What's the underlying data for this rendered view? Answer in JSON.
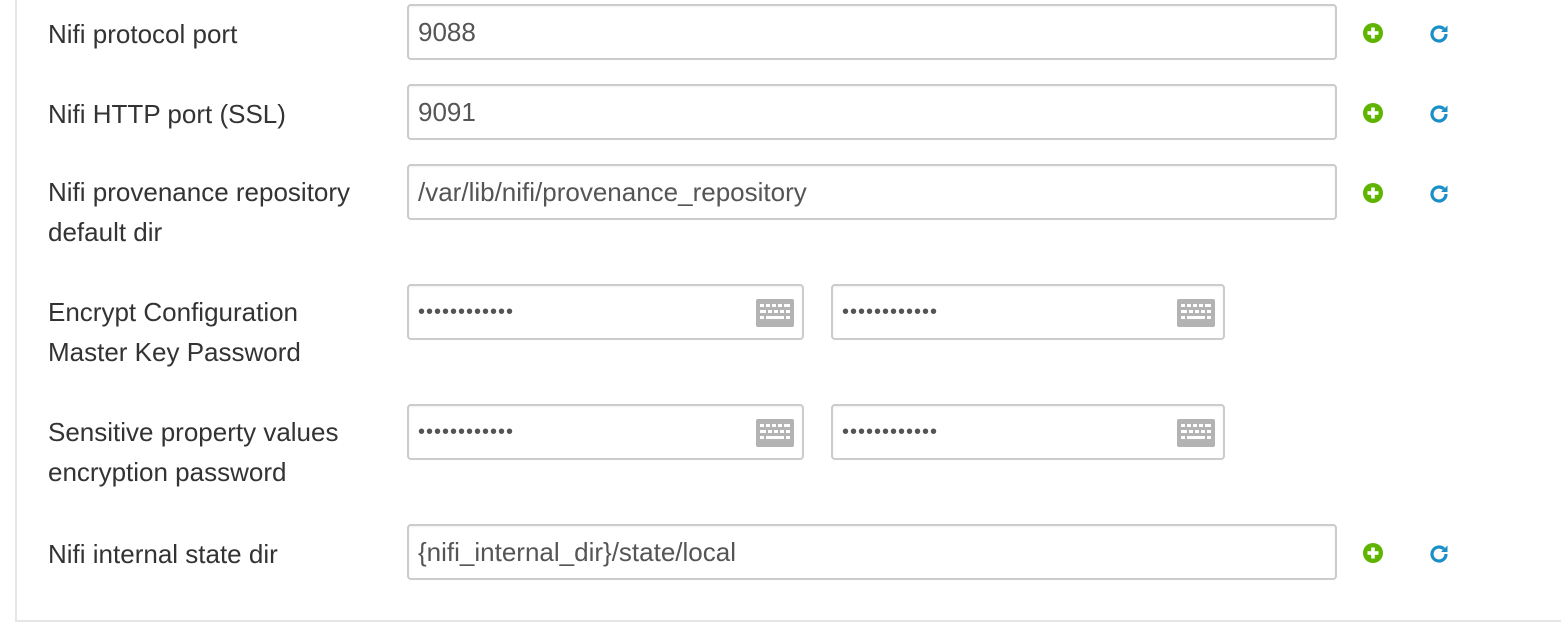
{
  "rows": [
    {
      "label": "Nifi protocol port",
      "value": "9088"
    },
    {
      "label": "Nifi HTTP port (SSL)",
      "value": "9091"
    },
    {
      "label": "Nifi provenance repository default dir",
      "value": "/var/lib/nifi/provenance_repository"
    },
    {
      "label": "Encrypt Configuration Master Key Password",
      "password": "••••••••••••",
      "confirm": "••••••••••••"
    },
    {
      "label": "Sensitive property values encryption password",
      "password": "••••••••••••",
      "confirm": "••••••••••••"
    },
    {
      "label": "Nifi internal state dir",
      "value": "{nifi_internal_dir}/state/local"
    }
  ],
  "icons": {
    "add": "plus-circle-icon",
    "reset": "refresh-icon",
    "keyboard": "keyboard-icon"
  },
  "colors": {
    "add_icon": "#5fb400",
    "reset_icon": "#1a8ec7",
    "keyboard_icon": "#b3b3b3",
    "border": "#cccccc",
    "text": "#333333"
  }
}
